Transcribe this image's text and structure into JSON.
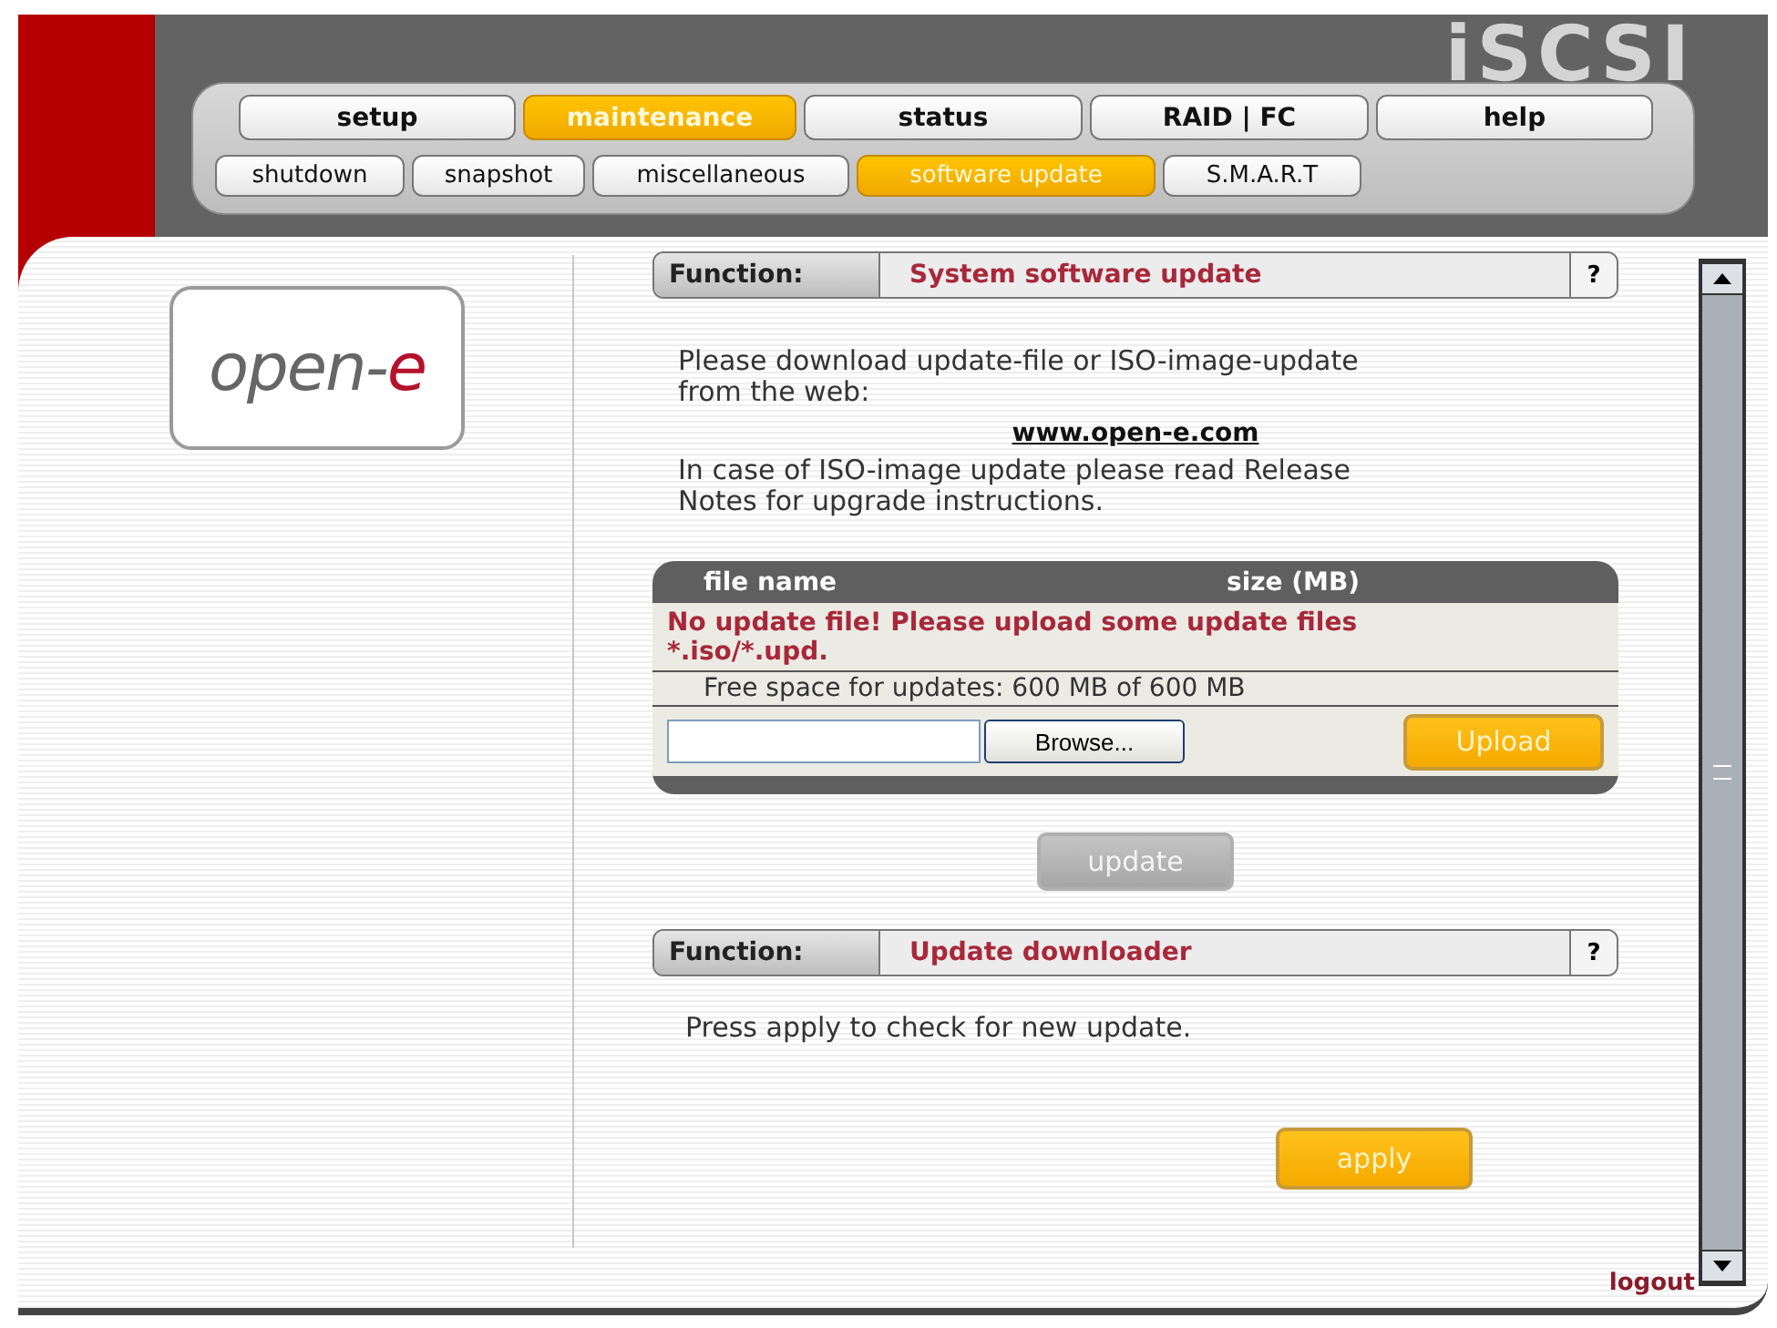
{
  "product_logo": "iSCSI",
  "main_tabs": [
    {
      "label": "setup",
      "selected": false
    },
    {
      "label": "maintenance",
      "selected": true
    },
    {
      "label": "status",
      "selected": false
    },
    {
      "label": "RAID | FC",
      "selected": false
    },
    {
      "label": "help",
      "selected": false
    }
  ],
  "sub_tabs": [
    {
      "label": "shutdown",
      "selected": false
    },
    {
      "label": "snapshot",
      "selected": false
    },
    {
      "label": "miscellaneous",
      "selected": false
    },
    {
      "label": "software update",
      "selected": true
    },
    {
      "label": "S.M.A.R.T",
      "selected": false
    }
  ],
  "brand_logo": {
    "text": "open-",
    "accent": "e"
  },
  "update_section": {
    "function_label": "Function:",
    "title": "System software update",
    "help": "?",
    "intro": "Please download update-file or ISO-image-update from the web:",
    "link": "www.open-e.com",
    "note": "In case of ISO-image update please read Release Notes for upgrade instructions.",
    "table": {
      "columns": [
        "file name",
        "size (MB)"
      ],
      "message": "No update file! Please upload some update files *.iso/*.upd.",
      "free_space": "Free space for updates: 600 MB of 600 MB",
      "browse": "Browse...",
      "upload": "Upload"
    },
    "update_button": {
      "label": "update",
      "disabled": true
    }
  },
  "downloader_section": {
    "function_label": "Function:",
    "title": "Update downloader",
    "help": "?",
    "text": "Press apply to check for new update.",
    "apply_button": {
      "label": "apply",
      "disabled": false
    }
  },
  "logout": "logout"
}
